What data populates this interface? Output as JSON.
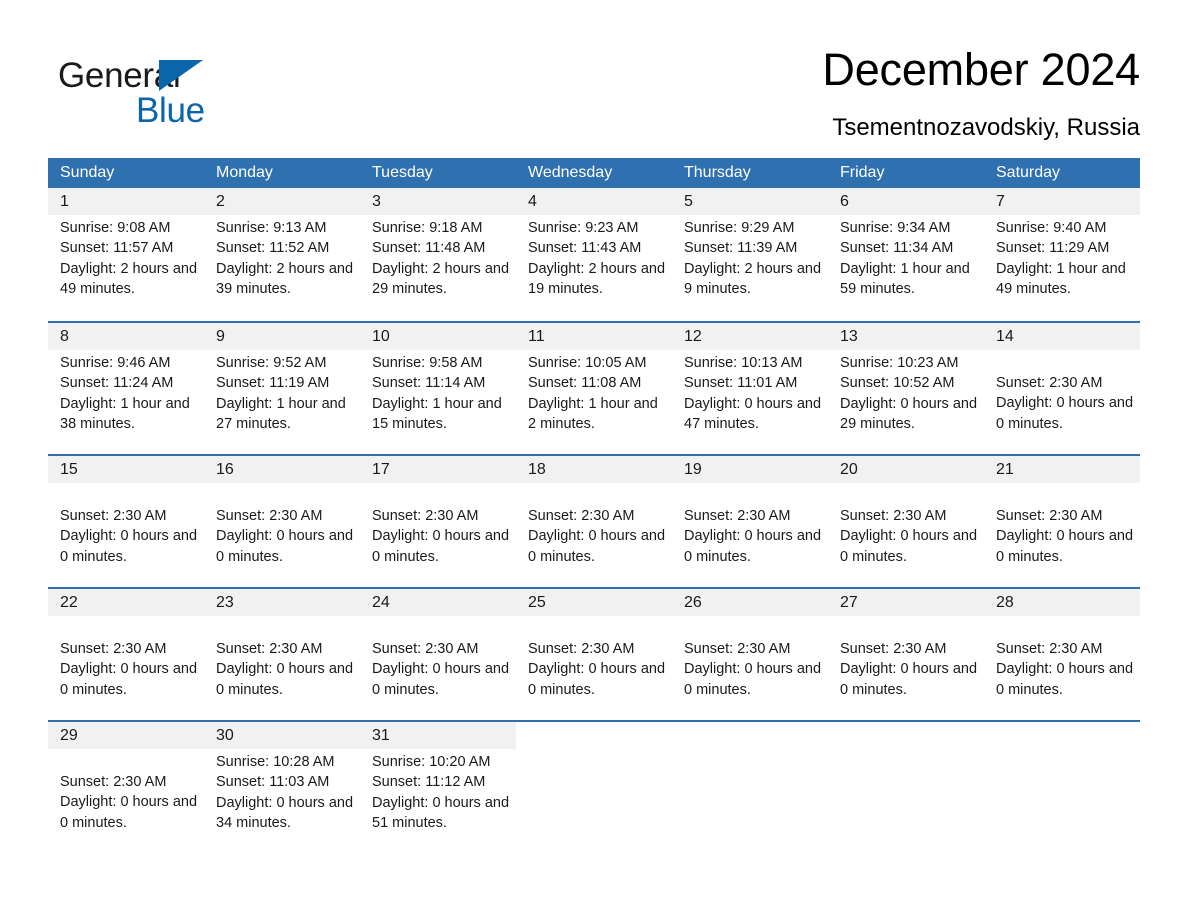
{
  "logo": {
    "word1": "General",
    "word2": "Blue",
    "triangle_color": "#0a65ab"
  },
  "header": {
    "title": "December 2024",
    "location": "Tsementnozavodskiy, Russia"
  },
  "colors": {
    "header_blue": "#2e70b0",
    "daynum_band": "#f1f1f1",
    "text": "#1a1a1a"
  },
  "weekdays": [
    "Sunday",
    "Monday",
    "Tuesday",
    "Wednesday",
    "Thursday",
    "Friday",
    "Saturday"
  ],
  "weeks": [
    {
      "days": [
        {
          "num": "1",
          "sunrise": "Sunrise: 9:08 AM",
          "sunset": "Sunset: 11:57 AM",
          "daylight": "Daylight: 2 hours and 49 minutes."
        },
        {
          "num": "2",
          "sunrise": "Sunrise: 9:13 AM",
          "sunset": "Sunset: 11:52 AM",
          "daylight": "Daylight: 2 hours and 39 minutes."
        },
        {
          "num": "3",
          "sunrise": "Sunrise: 9:18 AM",
          "sunset": "Sunset: 11:48 AM",
          "daylight": "Daylight: 2 hours and 29 minutes."
        },
        {
          "num": "4",
          "sunrise": "Sunrise: 9:23 AM",
          "sunset": "Sunset: 11:43 AM",
          "daylight": "Daylight: 2 hours and 19 minutes."
        },
        {
          "num": "5",
          "sunrise": "Sunrise: 9:29 AM",
          "sunset": "Sunset: 11:39 AM",
          "daylight": "Daylight: 2 hours and 9 minutes."
        },
        {
          "num": "6",
          "sunrise": "Sunrise: 9:34 AM",
          "sunset": "Sunset: 11:34 AM",
          "daylight": "Daylight: 1 hour and 59 minutes."
        },
        {
          "num": "7",
          "sunrise": "Sunrise: 9:40 AM",
          "sunset": "Sunset: 11:29 AM",
          "daylight": "Daylight: 1 hour and 49 minutes."
        }
      ]
    },
    {
      "days": [
        {
          "num": "8",
          "sunrise": "Sunrise: 9:46 AM",
          "sunset": "Sunset: 11:24 AM",
          "daylight": "Daylight: 1 hour and 38 minutes."
        },
        {
          "num": "9",
          "sunrise": "Sunrise: 9:52 AM",
          "sunset": "Sunset: 11:19 AM",
          "daylight": "Daylight: 1 hour and 27 minutes."
        },
        {
          "num": "10",
          "sunrise": "Sunrise: 9:58 AM",
          "sunset": "Sunset: 11:14 AM",
          "daylight": "Daylight: 1 hour and 15 minutes."
        },
        {
          "num": "11",
          "sunrise": "Sunrise: 10:05 AM",
          "sunset": "Sunset: 11:08 AM",
          "daylight": "Daylight: 1 hour and 2 minutes."
        },
        {
          "num": "12",
          "sunrise": "Sunrise: 10:13 AM",
          "sunset": "Sunset: 11:01 AM",
          "daylight": "Daylight: 0 hours and 47 minutes."
        },
        {
          "num": "13",
          "sunrise": "Sunrise: 10:23 AM",
          "sunset": "Sunset: 10:52 AM",
          "daylight": "Daylight: 0 hours and 29 minutes."
        },
        {
          "num": "14",
          "sunrise": "",
          "sunset": "Sunset: 2:30 AM",
          "daylight": "Daylight: 0 hours and 0 minutes."
        }
      ]
    },
    {
      "days": [
        {
          "num": "15",
          "sunrise": "",
          "sunset": "Sunset: 2:30 AM",
          "daylight": "Daylight: 0 hours and 0 minutes."
        },
        {
          "num": "16",
          "sunrise": "",
          "sunset": "Sunset: 2:30 AM",
          "daylight": "Daylight: 0 hours and 0 minutes."
        },
        {
          "num": "17",
          "sunrise": "",
          "sunset": "Sunset: 2:30 AM",
          "daylight": "Daylight: 0 hours and 0 minutes."
        },
        {
          "num": "18",
          "sunrise": "",
          "sunset": "Sunset: 2:30 AM",
          "daylight": "Daylight: 0 hours and 0 minutes."
        },
        {
          "num": "19",
          "sunrise": "",
          "sunset": "Sunset: 2:30 AM",
          "daylight": "Daylight: 0 hours and 0 minutes."
        },
        {
          "num": "20",
          "sunrise": "",
          "sunset": "Sunset: 2:30 AM",
          "daylight": "Daylight: 0 hours and 0 minutes."
        },
        {
          "num": "21",
          "sunrise": "",
          "sunset": "Sunset: 2:30 AM",
          "daylight": "Daylight: 0 hours and 0 minutes."
        }
      ]
    },
    {
      "days": [
        {
          "num": "22",
          "sunrise": "",
          "sunset": "Sunset: 2:30 AM",
          "daylight": "Daylight: 0 hours and 0 minutes."
        },
        {
          "num": "23",
          "sunrise": "",
          "sunset": "Sunset: 2:30 AM",
          "daylight": "Daylight: 0 hours and 0 minutes."
        },
        {
          "num": "24",
          "sunrise": "",
          "sunset": "Sunset: 2:30 AM",
          "daylight": "Daylight: 0 hours and 0 minutes."
        },
        {
          "num": "25",
          "sunrise": "",
          "sunset": "Sunset: 2:30 AM",
          "daylight": "Daylight: 0 hours and 0 minutes."
        },
        {
          "num": "26",
          "sunrise": "",
          "sunset": "Sunset: 2:30 AM",
          "daylight": "Daylight: 0 hours and 0 minutes."
        },
        {
          "num": "27",
          "sunrise": "",
          "sunset": "Sunset: 2:30 AM",
          "daylight": "Daylight: 0 hours and 0 minutes."
        },
        {
          "num": "28",
          "sunrise": "",
          "sunset": "Sunset: 2:30 AM",
          "daylight": "Daylight: 0 hours and 0 minutes."
        }
      ]
    },
    {
      "days": [
        {
          "num": "29",
          "sunrise": "",
          "sunset": "Sunset: 2:30 AM",
          "daylight": "Daylight: 0 hours and 0 minutes."
        },
        {
          "num": "30",
          "sunrise": "Sunrise: 10:28 AM",
          "sunset": "Sunset: 11:03 AM",
          "daylight": "Daylight: 0 hours and 34 minutes."
        },
        {
          "num": "31",
          "sunrise": "Sunrise: 10:20 AM",
          "sunset": "Sunset: 11:12 AM",
          "daylight": "Daylight: 0 hours and 51 minutes."
        },
        {
          "num": "",
          "sunrise": "",
          "sunset": "",
          "daylight": ""
        },
        {
          "num": "",
          "sunrise": "",
          "sunset": "",
          "daylight": ""
        },
        {
          "num": "",
          "sunrise": "",
          "sunset": "",
          "daylight": ""
        },
        {
          "num": "",
          "sunrise": "",
          "sunset": "",
          "daylight": ""
        }
      ]
    }
  ]
}
